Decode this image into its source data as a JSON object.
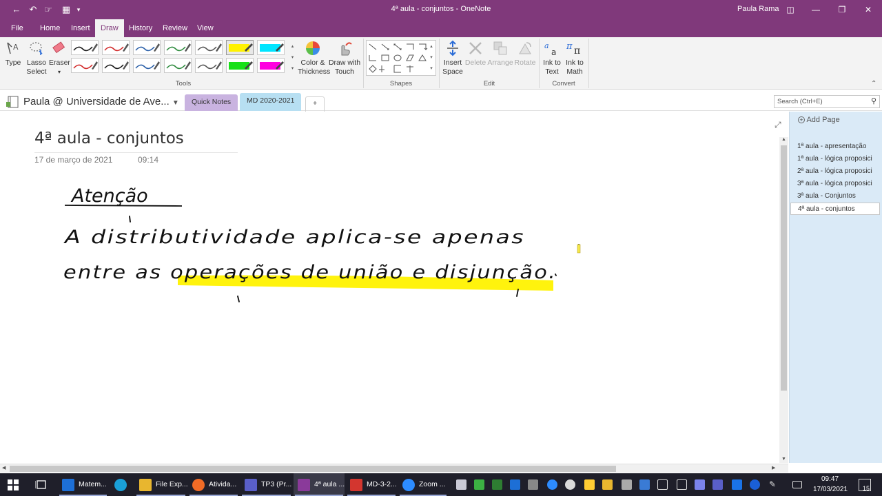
{
  "window": {
    "title": "4ª aula - conjuntos  -  OneNote",
    "user": "Paula Rama"
  },
  "menu": {
    "tabs": [
      "File",
      "Home",
      "Insert",
      "Draw",
      "History",
      "Review",
      "View"
    ],
    "active": "Draw"
  },
  "ribbon": {
    "tools": {
      "type_label": "Type",
      "lasso_label": "Lasso Select",
      "eraser_label": "Eraser",
      "group_label": "Tools",
      "pens_row1": [
        "#1a1a1a",
        "#d22a2a",
        "#2a5fa8",
        "#2e8b3e",
        "#555555",
        "#fff200",
        "#00e5ff"
      ],
      "pens_row2": [
        "#d22a2a",
        "#1a1a1a",
        "#2a5fa8",
        "#2e8b3e",
        "#555555",
        "#18e018",
        "#ff00e0"
      ]
    },
    "color_label": "Color & Thickness",
    "draw_touch_label": "Draw with Touch",
    "shapes_group_label": "Shapes",
    "edit": {
      "insert_space_label": "Insert Space",
      "delete_label": "Delete",
      "arrange_label": "Arrange",
      "rotate_label": "Rotate",
      "group_label": "Edit"
    },
    "convert": {
      "ink_text_label": "Ink to Text",
      "ink_math_label": "Ink to Math",
      "group_label": "Convert"
    }
  },
  "notebook": {
    "name": "Paula @ Universidade de Ave...",
    "sections": [
      {
        "label": "Quick Notes",
        "color": "#c9b3e0"
      },
      {
        "label": "MD 2020-2021",
        "color": "#b7dff2"
      }
    ],
    "add_label": "+",
    "search_placeholder": "Search (Ctrl+E)"
  },
  "page": {
    "title": "4ª aula - conjuntos",
    "date": "17 de março de 2021",
    "time": "09:14",
    "ink_lines": [
      "Atenção",
      "A distributividade aplica-se apenas",
      "entre as operações de união e disjunção."
    ],
    "highlight_color": "#fff200"
  },
  "pagelist": {
    "add_label": "Add Page",
    "pages": [
      "1ª aula - apresentação",
      "1ª aula - lógica proposici",
      "2ª aula - lógica proposici",
      "3ª aula - lógica proposici",
      "3ª aula - Conjuntos",
      "4ª aula - conjuntos"
    ],
    "active_index": 5
  },
  "taskbar": {
    "apps": [
      {
        "label": "Matem...",
        "color": "#1d6fd6"
      },
      {
        "label": "",
        "color": "#1aa0d8"
      },
      {
        "label": "File Exp...",
        "color": "#e8b62f"
      },
      {
        "label": "Ativida...",
        "color": "#f06b26"
      },
      {
        "label": "TP3 (Pr...",
        "color": "#5a5fc8"
      },
      {
        "label": "4ª aula ...",
        "color": "#8a3a9a"
      },
      {
        "label": "MD-3-2...",
        "color": "#d3362f"
      },
      {
        "label": "Zoom ...",
        "color": "#2d8cff"
      }
    ],
    "active_index": 5,
    "time": "09:47",
    "date": "17/03/2021",
    "notifications": "15"
  }
}
